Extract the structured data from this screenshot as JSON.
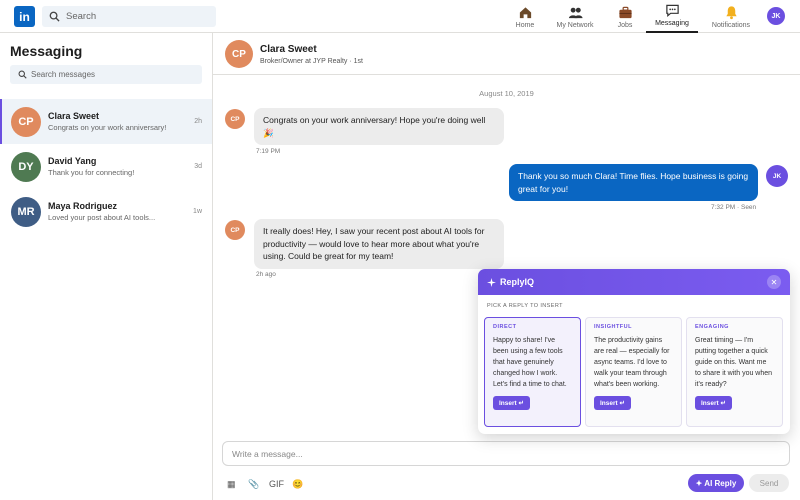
{
  "colors": {
    "brand": "#0a66c2",
    "accent": "#6b4fe0"
  },
  "topnav": {
    "search_placeholder": "Search",
    "logo": "in",
    "items": [
      {
        "label": "Home",
        "icon": "home-icon"
      },
      {
        "label": "My Network",
        "icon": "network-icon"
      },
      {
        "label": "Jobs",
        "icon": "briefcase-icon"
      },
      {
        "label": "Messaging",
        "icon": "chat-icon",
        "active": true
      },
      {
        "label": "Notifications",
        "icon": "bell-icon"
      }
    ],
    "me_initials": "JK"
  },
  "sidebar": {
    "title": "Messaging",
    "search_placeholder": "Search messages",
    "conversations": [
      {
        "initials": "CP",
        "name": "Clara Sweet",
        "preview": "Congrats on your work anniversary!",
        "time": "2h",
        "active": true
      },
      {
        "initials": "DY",
        "name": "David Yang",
        "preview": "Thank you for connecting!",
        "time": "3d"
      },
      {
        "initials": "MR",
        "name": "Maya Rodriguez",
        "preview": "Loved your post about AI tools...",
        "time": "1w"
      }
    ]
  },
  "chat": {
    "contact": {
      "initials": "CP",
      "name": "Clara Sweet",
      "subtitle": "Broker/Owner at JYP Realty · 1st"
    },
    "date": "August 10, 2019",
    "messages": [
      {
        "from": "them",
        "initials": "CP",
        "text": "Congrats on your work anniversary! Hope you're doing well 🎉",
        "meta": "7:19 PM"
      },
      {
        "from": "me",
        "initials": "JK",
        "text": "Thank you so much Clara! Time flies. Hope business is going great for you!",
        "meta": "7:32 PM · Seen"
      },
      {
        "from": "them",
        "initials": "CP",
        "text": "It really does! Hey, I saw your recent post about AI tools for productivity — would love to hear more about what you're using. Could be great for my team!",
        "meta": "2h ago"
      }
    ],
    "compose_placeholder": "Write a message...",
    "tools": {
      "image": "▦",
      "attach": "📎",
      "gif": "GIF",
      "emoji": "😊"
    },
    "ai_reply_label": "✦ AI Reply",
    "send_label": "Send"
  },
  "replyiq": {
    "title": "ReplyIQ",
    "close": "✕",
    "subtitle": "PICK A REPLY TO INSERT",
    "cards": [
      {
        "tone": "DIRECT",
        "text": "Happy to share! I've been using a few tools that have genuinely changed how I work. Let's find a time to chat.",
        "button": "Insert ↵",
        "selected": true
      },
      {
        "tone": "INSIGHTFUL",
        "text": "The productivity gains are real — especially for async teams. I'd love to walk your team through what's been working.",
        "button": "Insert ↵"
      },
      {
        "tone": "ENGAGING",
        "text": "Great timing — I'm putting together a quick guide on this. Want me to share it with you when it's ready?",
        "button": "Insert ↵"
      }
    ]
  }
}
